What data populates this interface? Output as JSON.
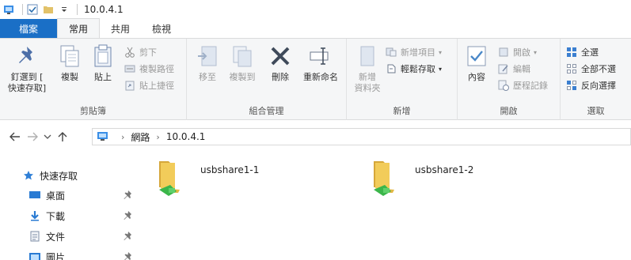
{
  "titlebar": {
    "title": "10.0.4.1"
  },
  "tabs": [
    {
      "label": "檔案"
    },
    {
      "label": "常用"
    },
    {
      "label": "共用"
    },
    {
      "label": "檢視"
    }
  ],
  "ribbon": {
    "clipboard": {
      "label": "剪貼簿",
      "pin": "釘選到 [\n快速存取]",
      "copy": "複製",
      "paste": "貼上",
      "cut": "剪下",
      "copy_path": "複製路徑",
      "paste_shortcut": "貼上捷徑"
    },
    "organize": {
      "label": "組合管理",
      "move_to": "移至",
      "copy_to": "複製到",
      "delete": "刪除",
      "rename": "重新命名"
    },
    "new": {
      "label": "新增",
      "new_folder": "新增\n資料夾",
      "new_item": "新增項目",
      "easy_access": "輕鬆存取"
    },
    "open": {
      "label": "開啟",
      "properties": "內容",
      "open": "開啟",
      "edit": "編輯",
      "history": "歷程記錄"
    },
    "select": {
      "label": "選取",
      "select_all": "全選",
      "select_none": "全部不選",
      "invert": "反向選擇"
    }
  },
  "address": {
    "crumbs": [
      "網路",
      "10.0.4.1"
    ]
  },
  "navpane": {
    "items": [
      {
        "label": "快速存取",
        "icon": "star-icon"
      },
      {
        "label": "桌面",
        "icon": "desktop-icon"
      },
      {
        "label": "下載",
        "icon": "download-icon"
      },
      {
        "label": "文件",
        "icon": "document-icon"
      },
      {
        "label": "圖片",
        "icon": "picture-icon"
      }
    ]
  },
  "content": {
    "items": [
      {
        "name": "usbshare1-1",
        "icon": "shared-folder-icon"
      },
      {
        "name": "usbshare1-2",
        "icon": "shared-folder-icon"
      }
    ]
  },
  "colors": {
    "file_tab": "#1a6fc6",
    "ribbon_bg": "#f5f6f7",
    "accent": "#1a6fc6"
  }
}
